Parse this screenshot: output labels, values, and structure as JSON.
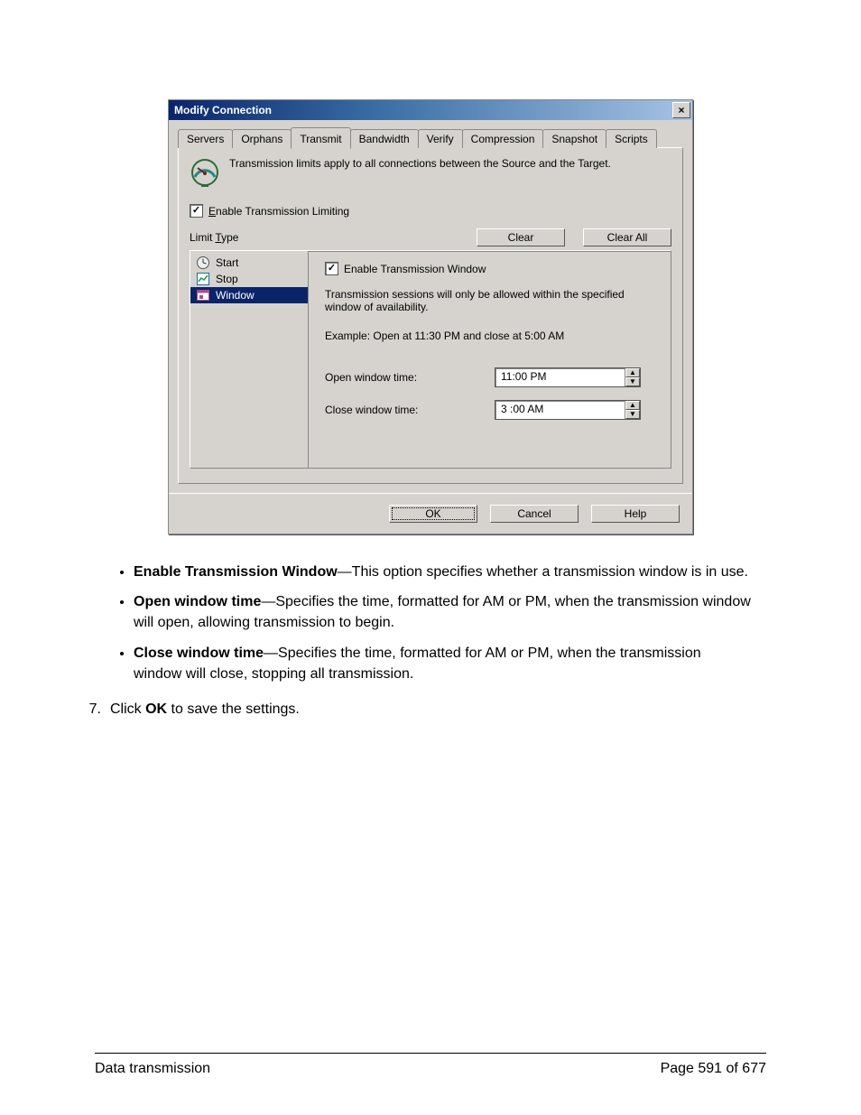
{
  "dialog": {
    "title": "Modify Connection",
    "close_glyph": "×",
    "tabs": [
      "Servers",
      "Orphans",
      "Transmit",
      "Bandwidth",
      "Verify",
      "Compression",
      "Snapshot",
      "Scripts"
    ],
    "active_tab_index": 2,
    "info_text": "Transmission limits apply to all connections between the Source and the Target.",
    "enable_limiting_checked": true,
    "enable_limiting_label_pre": "E",
    "enable_limiting_label_rest": "nable Transmission Limiting",
    "limit_type_label_pre": "Limit ",
    "limit_type_label_hot": "T",
    "limit_type_label_rest": "ype",
    "clear_btn": "Clear",
    "clear_all_btn": "Clear All",
    "list": [
      {
        "label": "Start"
      },
      {
        "label": "Stop"
      },
      {
        "label": "Window"
      }
    ],
    "list_selected_index": 2,
    "detail": {
      "enable_window_checked": true,
      "enable_window_label": "Enable Transmission Window",
      "desc": "Transmission sessions will only be allowed within the specified window of availability.",
      "example": "Example:  Open at 11:30 PM and close at 5:00 AM",
      "open_label": "Open window time:",
      "open_value": "11:00 PM",
      "close_label": "Close window time:",
      "close_value": "3 :00 AM"
    },
    "buttons": {
      "ok": "OK",
      "cancel": "Cancel",
      "help": "Help"
    }
  },
  "doc": {
    "b1_term": "Enable Transmission Window",
    "b1_text": "—This option specifies whether a transmission window is in use.",
    "b2_term": "Open window time",
    "b2_text": "—Specifies the time, formatted for AM or PM, when the transmission window will open, allowing transmission to begin.",
    "b3_term": "Close window time",
    "b3_text": "—Specifies the time, formatted for AM or PM, when the transmission window will close, stopping all transmission.",
    "step_num": "7.",
    "step_pre": "Click ",
    "step_bold": "OK",
    "step_post": " to save the settings."
  },
  "footer": {
    "left": "Data transmission",
    "right": "Page 591 of 677"
  }
}
